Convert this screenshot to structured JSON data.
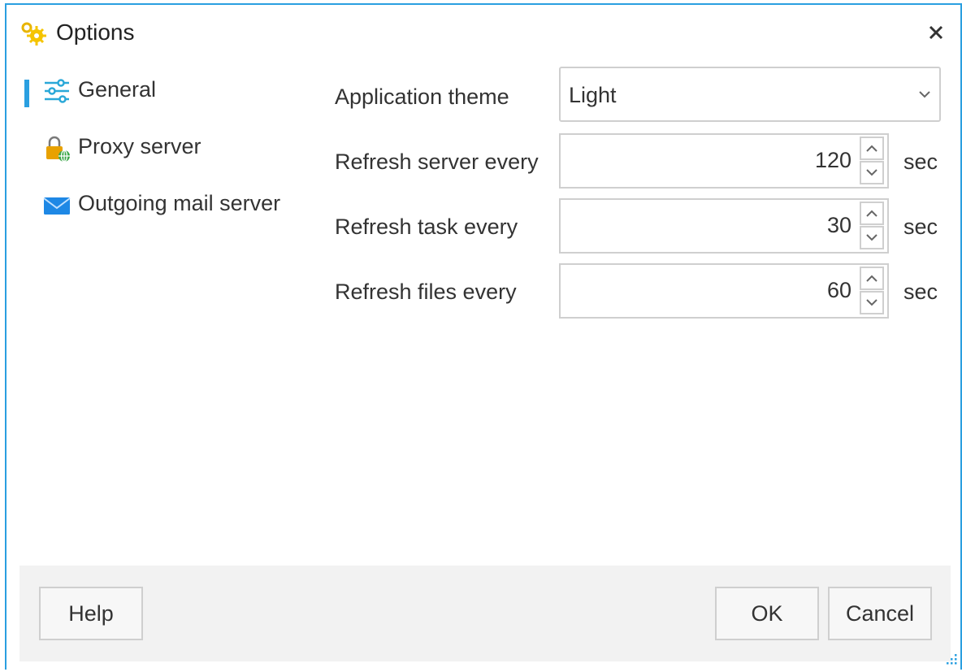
{
  "window": {
    "title": "Options",
    "accent_color": "#2a9fe0"
  },
  "nav": {
    "items": [
      {
        "label": "General",
        "icon": "sliders-icon",
        "selected": true
      },
      {
        "label": "Proxy server",
        "icon": "lock-globe-icon",
        "selected": false
      },
      {
        "label": "Outgoing mail server",
        "icon": "envelope-icon",
        "selected": false
      }
    ]
  },
  "general": {
    "theme_label": "Application theme",
    "theme_value": "Light",
    "refresh_server_label": "Refresh server every",
    "refresh_server_value": "120",
    "refresh_task_label": "Refresh task every",
    "refresh_task_value": "30",
    "refresh_files_label": "Refresh files every",
    "refresh_files_value": "60",
    "unit": "sec"
  },
  "footer": {
    "help_label": "Help",
    "ok_label": "OK",
    "cancel_label": "Cancel"
  }
}
